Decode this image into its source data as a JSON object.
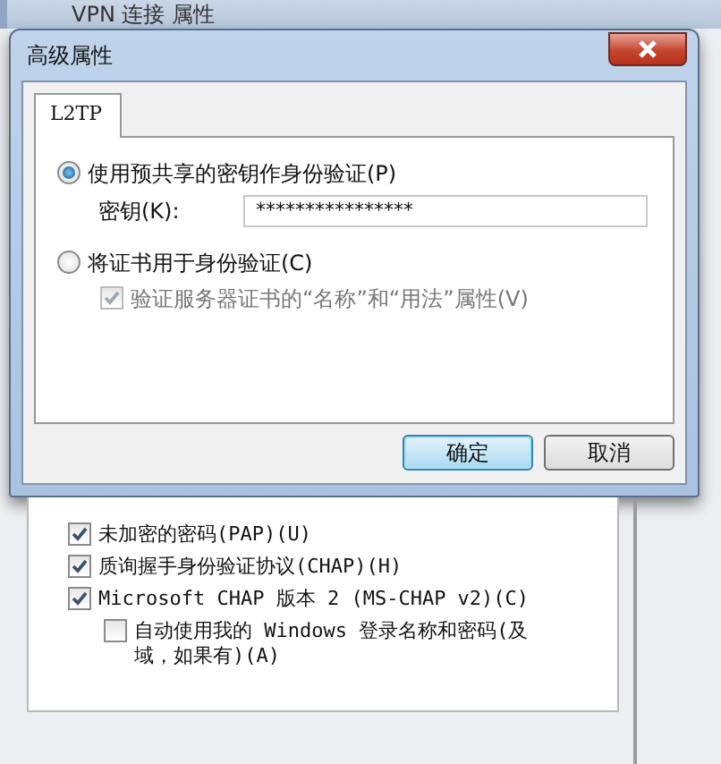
{
  "background_window": {
    "title": "VPN 连接 属性",
    "options": [
      {
        "label": "未加密的密码(PAP)(U)",
        "checked": true
      },
      {
        "label": "质询握手身份验证协议(CHAP)(H)",
        "checked": true
      },
      {
        "label": "Microsoft CHAP 版本 2 (MS-CHAP v2)(C)",
        "checked": true,
        "children": [
          {
            "label": "自动使用我的 Windows 登录名称和密码(及域，如果有)(A)",
            "checked": false
          }
        ]
      }
    ]
  },
  "dialog": {
    "title": "高级属性",
    "tabs": [
      {
        "label": "L2TP",
        "selected": true
      }
    ],
    "auth_options": [
      {
        "kind": "radio",
        "label": "使用预共享的密钥作身份验证(P)",
        "selected": true,
        "field": {
          "label": "密钥(K):",
          "value": "****************"
        }
      },
      {
        "kind": "radio",
        "label": "将证书用于身份验证(C)",
        "selected": false,
        "sub_option": {
          "label": "验证服务器证书的“名称”和“用法”属性(V)",
          "checked": true,
          "disabled": true
        }
      }
    ],
    "buttons": [
      {
        "label": "确定",
        "default": true
      },
      {
        "label": "取消",
        "default": false
      }
    ]
  }
}
